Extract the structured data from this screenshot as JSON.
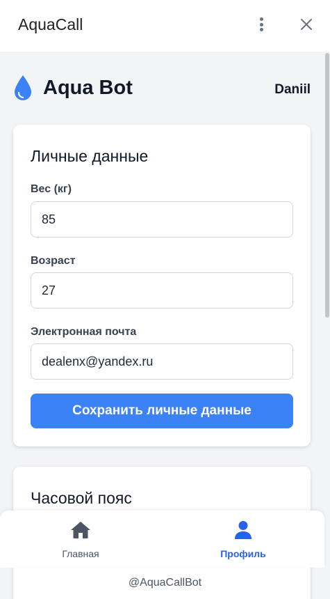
{
  "window": {
    "title": "AquaCall"
  },
  "header": {
    "brand": "Aqua Bot",
    "user": "Daniil"
  },
  "personal": {
    "title": "Личные данные",
    "weight_label": "Вес (кг)",
    "weight_value": "85",
    "age_label": "Возраст",
    "age_value": "27",
    "email_label": "Электронная почта",
    "email_value": "dealenx@yandex.ru",
    "save_label": "Сохранить личные данные"
  },
  "timezone": {
    "title": "Часовой пояс"
  },
  "nav": {
    "items": [
      {
        "label": "Главная",
        "icon": "home-icon",
        "active": false
      },
      {
        "label": "Профиль",
        "icon": "user-icon",
        "active": true
      }
    ]
  },
  "footer": {
    "handle": "@AquaCallBot"
  },
  "colors": {
    "accent": "#3b82f6",
    "active_nav": "#2563eb",
    "background": "#f3f4f6"
  }
}
